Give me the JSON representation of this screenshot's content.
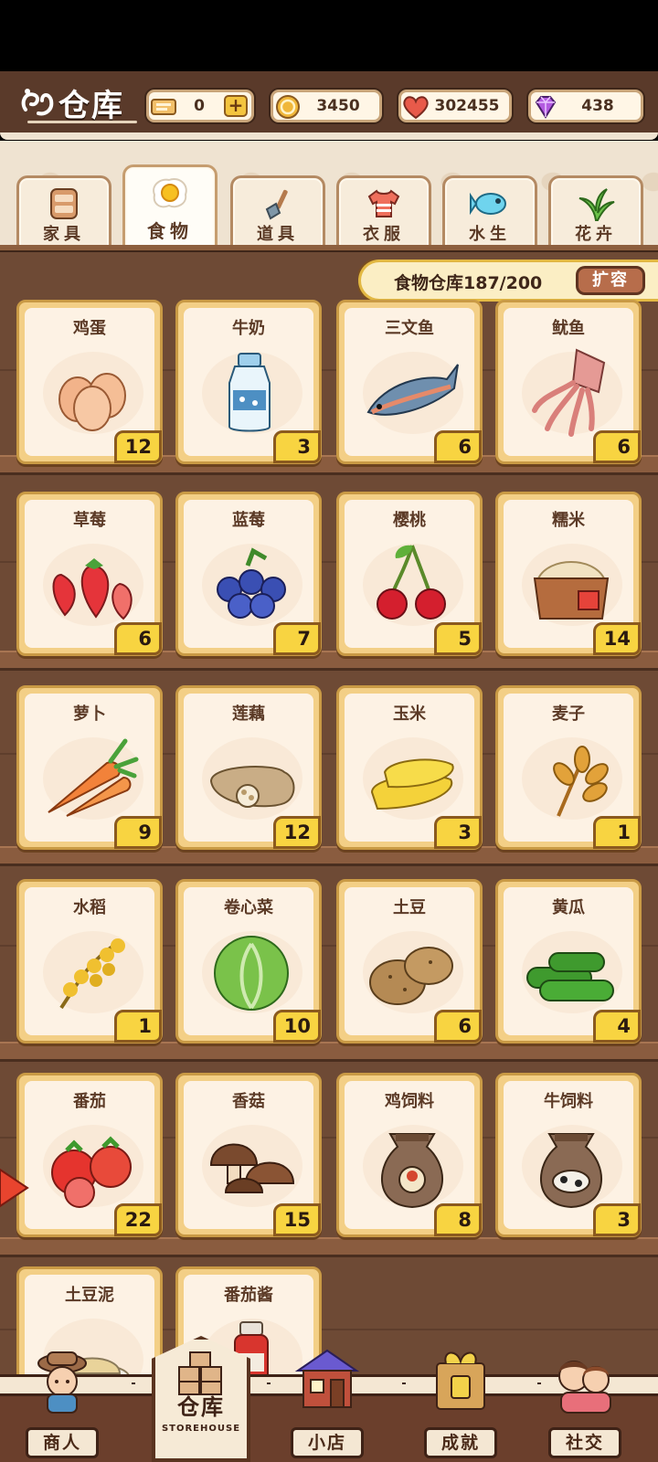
{
  "header": {
    "title": "仓库",
    "currencies": [
      {
        "name": "ticket",
        "value": "0",
        "icon": "ticket-icon"
      },
      {
        "name": "coin",
        "value": "3450",
        "icon": "coin-icon"
      },
      {
        "name": "heart",
        "value": "302455",
        "icon": "heart-icon"
      },
      {
        "name": "gem",
        "value": "438",
        "icon": "gem-icon"
      }
    ],
    "plus_label": "+"
  },
  "tabs": [
    {
      "label": "家具",
      "icon": "cabinet-icon",
      "active": false
    },
    {
      "label": "食物",
      "icon": "fried-egg-icon",
      "active": true
    },
    {
      "label": "道具",
      "icon": "shovel-icon",
      "active": false
    },
    {
      "label": "衣服",
      "icon": "shirt-icon",
      "active": false
    },
    {
      "label": "水生",
      "icon": "fish-icon",
      "active": false
    },
    {
      "label": "花卉",
      "icon": "plant-icon",
      "active": false
    }
  ],
  "capacity": {
    "text": "食物仓库187/200",
    "expand_label": "扩容"
  },
  "items": [
    {
      "name": "鸡蛋",
      "count": "12",
      "icon": "eggs-icon"
    },
    {
      "name": "牛奶",
      "count": "3",
      "icon": "milk-bottle-icon"
    },
    {
      "name": "三文鱼",
      "count": "6",
      "icon": "salmon-icon"
    },
    {
      "name": "鱿鱼",
      "count": "6",
      "icon": "squid-icon"
    },
    {
      "name": "草莓",
      "count": "6",
      "icon": "strawberry-icon"
    },
    {
      "name": "蓝莓",
      "count": "7",
      "icon": "blueberry-icon"
    },
    {
      "name": "樱桃",
      "count": "5",
      "icon": "cherry-icon"
    },
    {
      "name": "糯米",
      "count": "14",
      "icon": "rice-basket-icon"
    },
    {
      "name": "萝卜",
      "count": "9",
      "icon": "carrot-icon"
    },
    {
      "name": "莲藕",
      "count": "12",
      "icon": "lotus-root-icon"
    },
    {
      "name": "玉米",
      "count": "3",
      "icon": "corn-icon"
    },
    {
      "name": "麦子",
      "count": "1",
      "icon": "wheat-icon"
    },
    {
      "name": "水稻",
      "count": "1",
      "icon": "rice-plant-icon"
    },
    {
      "name": "卷心菜",
      "count": "10",
      "icon": "cabbage-icon"
    },
    {
      "name": "土豆",
      "count": "6",
      "icon": "potato-icon"
    },
    {
      "name": "黄瓜",
      "count": "4",
      "icon": "cucumber-icon"
    },
    {
      "name": "番茄",
      "count": "22",
      "icon": "tomato-icon"
    },
    {
      "name": "香菇",
      "count": "15",
      "icon": "mushroom-icon"
    },
    {
      "name": "鸡饲料",
      "count": "8",
      "icon": "chicken-feed-sack-icon"
    },
    {
      "name": "牛饲料",
      "count": "3",
      "icon": "cow-feed-sack-icon"
    },
    {
      "name": "土豆泥",
      "count": "",
      "icon": "mashed-potato-icon"
    },
    {
      "name": "番茄酱",
      "count": "",
      "icon": "ketchup-icon"
    }
  ],
  "nav": [
    {
      "label": "商人",
      "icon": "merchant-icon",
      "active": false
    },
    {
      "label": "仓库",
      "sub": "STOREHOUSE",
      "icon": "boxes-icon",
      "active": true
    },
    {
      "label": "小店",
      "icon": "shop-icon",
      "active": false
    },
    {
      "label": "成就",
      "icon": "trophy-box-icon",
      "active": false
    },
    {
      "label": "社交",
      "icon": "friends-icon",
      "active": false
    }
  ],
  "colors": {
    "header_bg": "#5a3a2a",
    "card_border": "#f3cf86",
    "count_badge": "#f8d441",
    "capacity_bg": "#fbeec4",
    "expand_button": "#b76d4b"
  }
}
